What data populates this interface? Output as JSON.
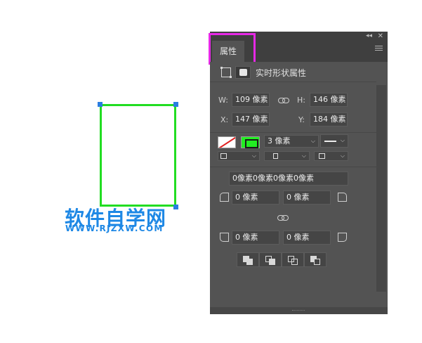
{
  "canvas": {
    "watermark_cn": "软件自学网",
    "watermark_en": "WWW.RJZXW.COM",
    "shape_stroke_color": "#22dd22",
    "handle_color": "#2a7de1"
  },
  "panel": {
    "tab_label": "属性",
    "shape_type_label": "实时形状属性",
    "highlight_color": "#e629e6",
    "transform": {
      "w_label": "W:",
      "w_value": "109 像素",
      "h_label": "H:",
      "h_value": "146 像素",
      "x_label": "X:",
      "x_value": "147 像素",
      "y_label": "Y:",
      "y_value": "184 像素"
    },
    "appearance": {
      "fill_icon": "no-fill-swatch",
      "stroke_color": "#22ee22",
      "stroke_width": "3 像素",
      "stroke_style_icon": "solid-line"
    },
    "corners": {
      "combined_value": "0像素0像素0像素0像素",
      "top_left": "0 像素",
      "top_right": "0 像素",
      "bottom_left": "0 像素",
      "bottom_right": "0 像素"
    },
    "pathfinder_icons": [
      "combine-shapes-icon",
      "subtract-front-icon",
      "intersect-shapes-icon",
      "exclude-overlap-icon"
    ]
  }
}
